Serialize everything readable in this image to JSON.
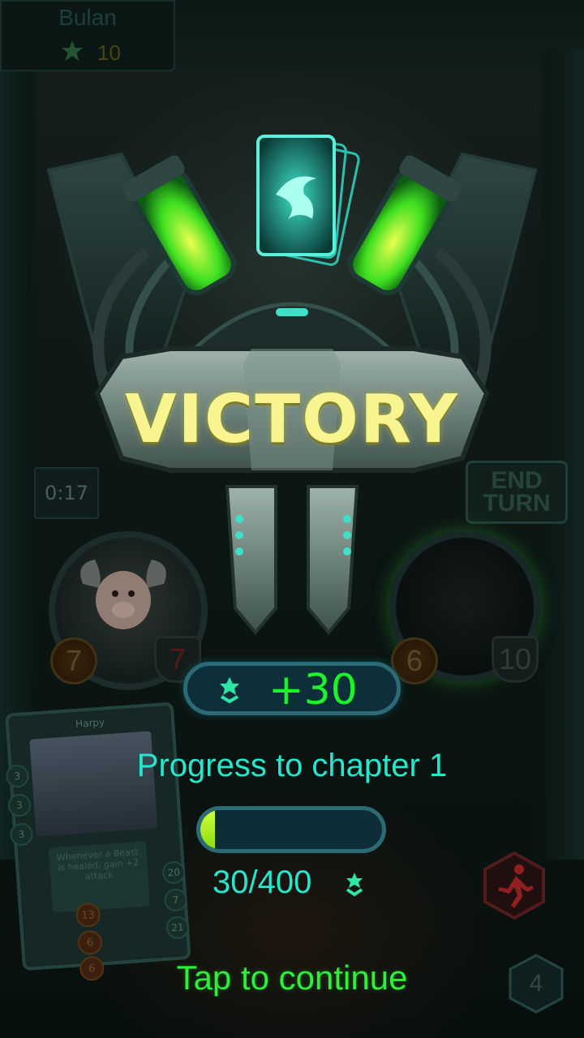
{
  "player": {
    "name": "Bulan",
    "score": "10"
  },
  "battle": {
    "timer": "0:17",
    "end_turn_label": [
      "END",
      "TURN"
    ],
    "left_unit": {
      "attack": "7",
      "health": "7"
    },
    "right_unit": {
      "attack": "6",
      "health": "10"
    },
    "turn_number": "4"
  },
  "hand_card": {
    "name": "Harpy",
    "text": "Whenever a Beast is healed, gain +2 attack",
    "costs": [
      "3",
      "3",
      "3"
    ],
    "side_numbers": [
      "20",
      "7",
      "21"
    ],
    "coins": [
      "13",
      "6",
      "6"
    ]
  },
  "result": {
    "title": "VICTORY",
    "reward": "+30",
    "progress_label": "Progress to chapter 1",
    "progress_value": 30,
    "progress_max": 400,
    "progress_text": "30/400",
    "continue_label": "Tap to continue"
  },
  "colors": {
    "victory_text": "#f8f490",
    "reward_text": "#1ef22c",
    "progress_text": "#28e6cc",
    "continue_text": "#2cf03a",
    "progress_fill": "#b6f020"
  },
  "icons": {
    "star": "chevron-star-icon",
    "flee": "running-man-icon",
    "emblem": "dragon-card-emblem-icon"
  }
}
